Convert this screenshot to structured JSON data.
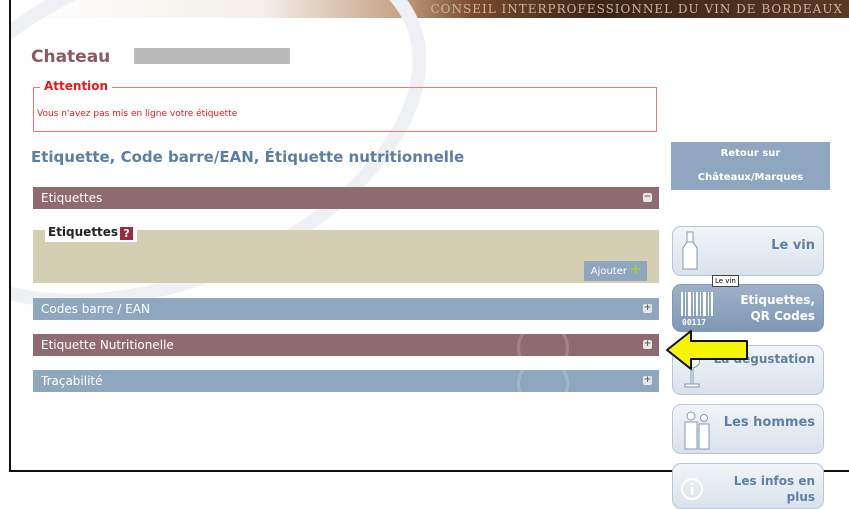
{
  "banner": {
    "text": "CONSEIL INTERPROFESSIONNEL DU VIN DE BORDEAUX"
  },
  "page": {
    "title": "Chateau"
  },
  "attention": {
    "legend": "Attention",
    "message": "Vous n'avez pas mis en ligne votre étiquette"
  },
  "section": {
    "heading": "Etiquette, Code barre/EAN, Étiquette nutritionnelle"
  },
  "accordion": [
    {
      "label": "Etiquettes",
      "state": "expanded",
      "toggle": "−",
      "color": "#8f6a70"
    },
    {
      "label": "Codes barre / EAN",
      "state": "collapsed",
      "toggle": "+",
      "color": "#8fa6c1"
    },
    {
      "label": "Etiquette Nutritionelle",
      "state": "collapsed",
      "toggle": "+",
      "color": "#8f6a70"
    },
    {
      "label": "Traçabilité",
      "state": "collapsed",
      "toggle": "+",
      "color": "#8fa6c1"
    }
  ],
  "etiquettes_panel": {
    "legend": "Etiquettes",
    "help_icon": "?",
    "add_label": "Ajouter",
    "add_icon": "+"
  },
  "sidebar": {
    "retour_line1": "Retour sur",
    "retour_line2": "Châteaux/Marques",
    "tabs": [
      {
        "label": "Le vin",
        "icon": "bottle-icon"
      },
      {
        "label_line1": "Etiquettes,",
        "label_line2": "QR Codes",
        "icon": "barcode-icon",
        "barcode_digits": "00117",
        "active": true
      },
      {
        "label": "La dégustation",
        "icon": "wine-glass-icon"
      },
      {
        "label": "Les hommes",
        "icon": "people-icon"
      },
      {
        "label_line1": "Les infos en",
        "label_line2": "plus",
        "icon": "info-icon"
      }
    ],
    "tooltip": "Le vin"
  },
  "annotation": {
    "arrow_color": "#f5f500"
  }
}
